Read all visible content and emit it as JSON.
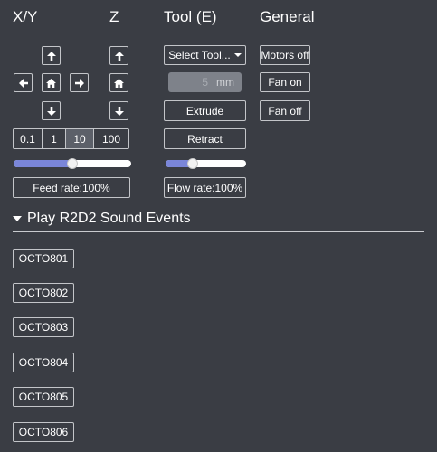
{
  "headings": {
    "xy": "X/Y",
    "z": "Z",
    "tool": "Tool (E)",
    "general": "General"
  },
  "jog": {
    "icons": {
      "up": "arrow-up-icon",
      "down": "arrow-down-icon",
      "left": "arrow-left-icon",
      "right": "arrow-right-icon",
      "home": "home-icon"
    },
    "step_options": [
      "0.1",
      "1",
      "10",
      "100"
    ],
    "active_step": "10",
    "feed_rate_label": "Feed rate:100%",
    "feed_rate_slider_percent": 50
  },
  "tool": {
    "select_label": "Select Tool...",
    "extrude_amount": "5",
    "extrude_unit": "mm",
    "extrude_label": "Extrude",
    "retract_label": "Retract",
    "flow_rate_label": "Flow rate:100%",
    "flow_rate_slider_percent": 34
  },
  "general": {
    "motors_off": "Motors off",
    "fan_on": "Fan on",
    "fan_off": "Fan off"
  },
  "sounds": {
    "title": "Play R2D2 Sound Events",
    "buttons": [
      "OCTO801",
      "OCTO802",
      "OCTO803",
      "OCTO804",
      "OCTO805",
      "OCTO806"
    ]
  },
  "colors": {
    "background": "#3a3d44",
    "slider_fill": "#7a86d9",
    "border": "#c3c5c9"
  }
}
